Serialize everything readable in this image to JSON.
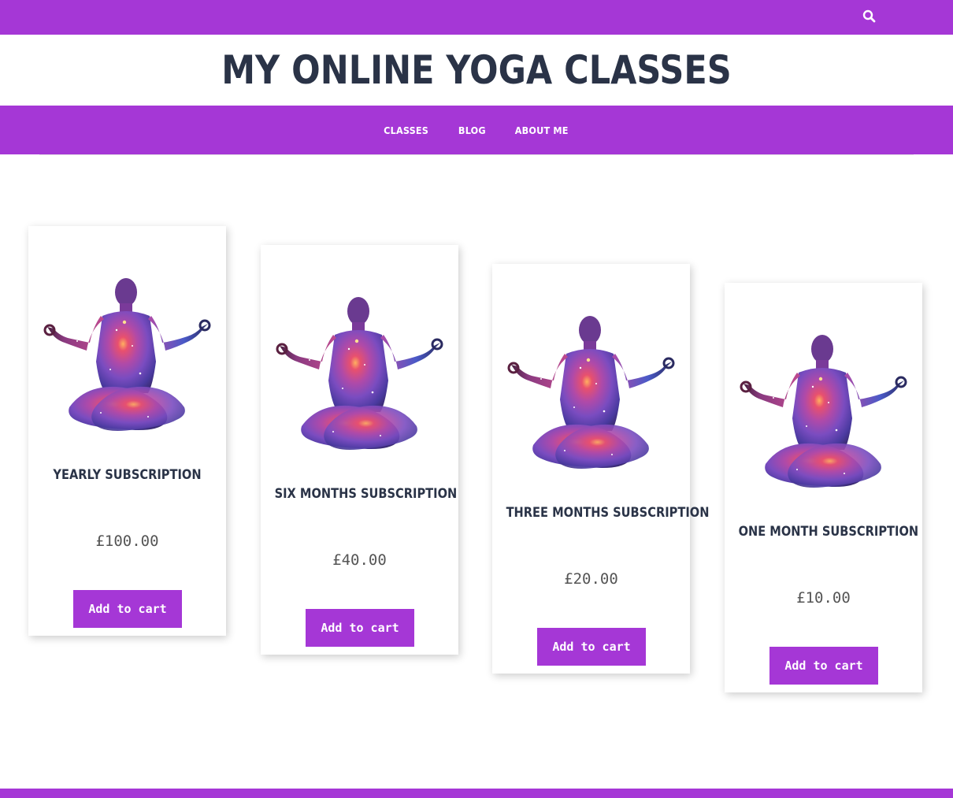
{
  "header": {
    "search_icon": "search-icon",
    "site_title": "MY ONLINE YOGA CLASSES"
  },
  "nav": {
    "items": [
      {
        "label": "CLASSES"
      },
      {
        "label": "BLOG"
      },
      {
        "label": "ABOUT ME"
      }
    ]
  },
  "products": [
    {
      "title": "YEARLY SUBSCRIPTION",
      "price": "£100.00",
      "button_label": "Add to cart",
      "image_icon": "meditation-silhouette-icon"
    },
    {
      "title": "SIX MONTHS SUBSCRIPTION",
      "price": "£40.00",
      "button_label": "Add to cart",
      "image_icon": "meditation-silhouette-icon"
    },
    {
      "title": "THREE MONTHS SUBSCRIPTION",
      "price": "£20.00",
      "button_label": "Add to cart",
      "image_icon": "meditation-silhouette-icon"
    },
    {
      "title": "ONE MONTH SUBSCRIPTION",
      "price": "£10.00",
      "button_label": "Add to cart",
      "image_icon": "meditation-silhouette-icon"
    }
  ],
  "colors": {
    "accent": "#a537d6",
    "title_text": "#2a3347",
    "price_text": "#555555",
    "background": "#ffffff"
  }
}
